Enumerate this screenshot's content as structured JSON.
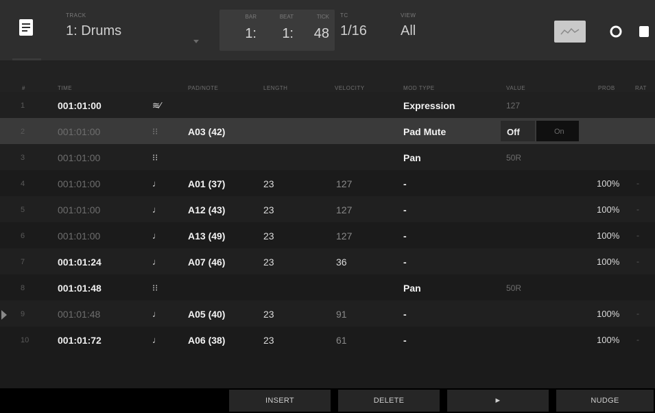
{
  "header": {
    "track": {
      "label": "TRACK",
      "value": "1: Drums"
    },
    "position": {
      "bar": {
        "label": "BAR",
        "value": "1:"
      },
      "beat": {
        "label": "BEAT",
        "value": "1:"
      },
      "tick": {
        "label": "TICK",
        "value": "48"
      }
    },
    "tc": {
      "label": "TC",
      "value": "1/16"
    },
    "view": {
      "label": "VIEW",
      "value": "All"
    }
  },
  "columns": {
    "num": "#",
    "time": "TIME",
    "pad_note": "PAD/NOTE",
    "length": "LENGTH",
    "velocity": "VELOCITY",
    "mod_type": "MOD TYPE",
    "value": "VALUE",
    "prob": "PROB",
    "rat": "RAT"
  },
  "rows": [
    {
      "num": "1",
      "time": "001:01:00",
      "icon": "≋⁄",
      "pad": "",
      "length": "",
      "velocity": "",
      "mod": "Expression",
      "value": "127",
      "prob": "",
      "rat": ""
    },
    {
      "num": "2",
      "time": "001:01:00",
      "icon": "⁝⁝",
      "pad": "A03 (42)",
      "length": "",
      "velocity": "",
      "mod": "Pad Mute",
      "value": "",
      "prob": "",
      "rat": "",
      "toggle_off": "Off",
      "toggle_on": "On"
    },
    {
      "num": "3",
      "time": "001:01:00",
      "icon": "⁝⁝",
      "pad": "",
      "length": "",
      "velocity": "",
      "mod": "Pan",
      "value": "50R",
      "prob": "",
      "rat": ""
    },
    {
      "num": "4",
      "time": "001:01:00",
      "icon": "♩",
      "pad": "A01 (37)",
      "length": "23",
      "velocity": "127",
      "mod": "-",
      "value": "",
      "prob": "100%",
      "rat": "-"
    },
    {
      "num": "5",
      "time": "001:01:00",
      "icon": "♩",
      "pad": "A12 (43)",
      "length": "23",
      "velocity": "127",
      "mod": "-",
      "value": "",
      "prob": "100%",
      "rat": "-"
    },
    {
      "num": "6",
      "time": "001:01:00",
      "icon": "♩",
      "pad": "A13 (49)",
      "length": "23",
      "velocity": "127",
      "mod": "-",
      "value": "",
      "prob": "100%",
      "rat": "-"
    },
    {
      "num": "7",
      "time": "001:01:24",
      "icon": "♩",
      "pad": "A07 (46)",
      "length": "23",
      "velocity": "36",
      "mod": "-",
      "value": "",
      "prob": "100%",
      "rat": "-"
    },
    {
      "num": "8",
      "time": "001:01:48",
      "icon": "⁝⁝",
      "pad": "",
      "length": "",
      "velocity": "",
      "mod": "Pan",
      "value": "50R",
      "prob": "",
      "rat": ""
    },
    {
      "num": "9",
      "time": "001:01:48",
      "icon": "♩",
      "pad": "A05 (40)",
      "length": "23",
      "velocity": "91",
      "mod": "-",
      "value": "",
      "prob": "100%",
      "rat": "-"
    },
    {
      "num": "10",
      "time": "001:01:72",
      "icon": "♩",
      "pad": "A06 (38)",
      "length": "23",
      "velocity": "61",
      "mod": "-",
      "value": "",
      "prob": "100%",
      "rat": "-"
    }
  ],
  "footer": {
    "insert": "INSERT",
    "delete": "DELETE",
    "play": "►",
    "nudge": "NUDGE"
  },
  "icons": {
    "menu": "list-menu-icon",
    "waveform": "waveform-icon",
    "settings": "gear-icon",
    "stop": "stop-icon"
  },
  "colors": {
    "selected_row": "#3a3a3a",
    "header_bg": "#2e2e2e",
    "footer_bg": "#000000"
  }
}
